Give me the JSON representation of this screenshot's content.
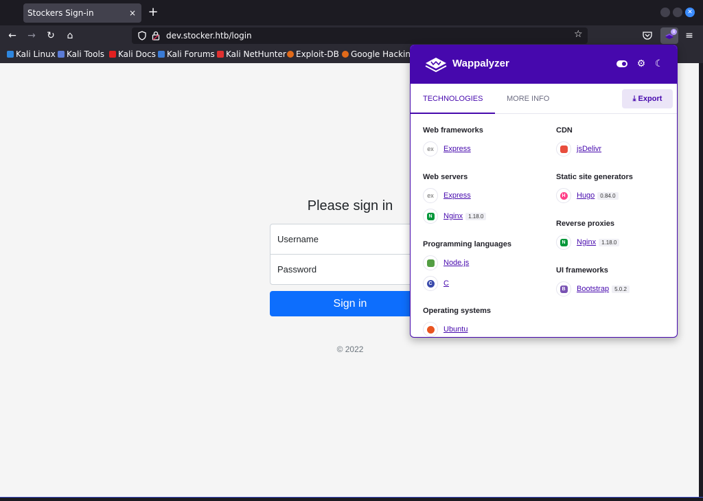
{
  "browser": {
    "tab_title": "Stockers Sign-in",
    "tab_close": "×",
    "new_tab": "+",
    "url": "dev.stocker.htb/login"
  },
  "bookmarks": [
    {
      "label": "Kali Linux",
      "color": "#2e86de"
    },
    {
      "label": "Kali Tools",
      "color": "#5b7bd5"
    },
    {
      "label": "Kali Docs",
      "color": "#e02020"
    },
    {
      "label": "Kali Forums",
      "color": "#3a7bd5"
    },
    {
      "label": "Kali NetHunter",
      "color": "#e03030"
    },
    {
      "label": "Exploit-DB",
      "color": "#e06a1a"
    },
    {
      "label": "Google Hacking",
      "color": "#e06a1a"
    }
  ],
  "page": {
    "title": "Please sign in",
    "username_placeholder": "Username",
    "password_placeholder": "Password",
    "signin_label": "Sign in",
    "copyright": "© 2022"
  },
  "wappalyzer": {
    "title": "Wappalyzer",
    "tab_technologies": "TECHNOLOGIES",
    "tab_more_info": "MORE INFO",
    "export_label": "Export",
    "brand_color": "#4608ad",
    "left_categories": [
      {
        "name": "Web frameworks",
        "items": [
          {
            "name": "Express",
            "icon": "ex",
            "version": ""
          }
        ]
      },
      {
        "name": "Web servers",
        "items": [
          {
            "name": "Express",
            "icon": "ex",
            "version": ""
          },
          {
            "name": "Nginx",
            "icon": "nginx",
            "version": "1.18.0"
          }
        ]
      },
      {
        "name": "Programming languages",
        "items": [
          {
            "name": "Node.js",
            "icon": "nodejs",
            "version": ""
          },
          {
            "name": "C",
            "icon": "c",
            "version": ""
          }
        ]
      },
      {
        "name": "Operating systems",
        "items": [
          {
            "name": "Ubuntu",
            "icon": "ubuntu",
            "version": ""
          }
        ]
      }
    ],
    "right_categories": [
      {
        "name": "CDN",
        "items": [
          {
            "name": "jsDelivr",
            "icon": "jsdelivr",
            "version": ""
          }
        ]
      },
      {
        "name": "Static site generators",
        "items": [
          {
            "name": "Hugo",
            "icon": "hugo",
            "version": "0.84.0"
          }
        ]
      },
      {
        "name": "Reverse proxies",
        "items": [
          {
            "name": "Nginx",
            "icon": "nginx",
            "version": "1.18.0"
          }
        ]
      },
      {
        "name": "UI frameworks",
        "items": [
          {
            "name": "Bootstrap",
            "icon": "bootstrap",
            "version": "5.0.2"
          }
        ]
      }
    ]
  }
}
